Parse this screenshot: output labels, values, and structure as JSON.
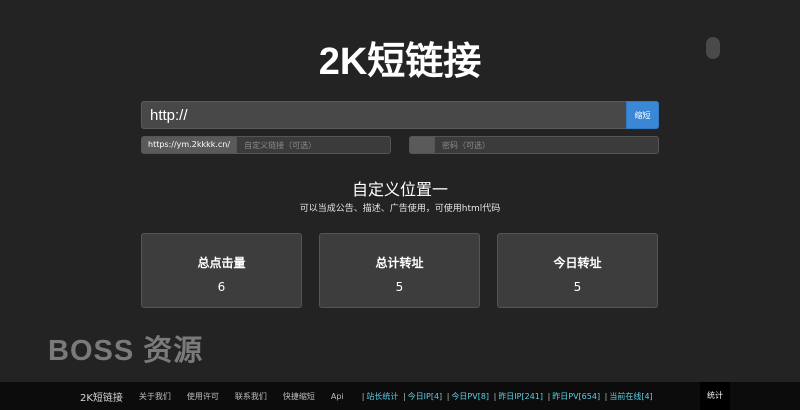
{
  "site": {
    "title": "2K短链接"
  },
  "shortener": {
    "url_value": "http://",
    "shorten_label": "缩短",
    "domain_prefix": "https://ym.2kkkk.cn/",
    "alias_placeholder": "自定义链接（可选）",
    "password_placeholder": "密码（可选）"
  },
  "ad": {
    "title": "自定义位置一",
    "description": "可以当成公告、描述、广告使用，可使用html代码"
  },
  "stats": [
    {
      "label": "总点击量",
      "value": "6"
    },
    {
      "label": "总计转址",
      "value": "5"
    },
    {
      "label": "今日转址",
      "value": "5"
    }
  ],
  "watermark": "BOSS 资源",
  "footer": {
    "brand": "2K短链接",
    "links": [
      "关于我们",
      "使用许可",
      "联系我们",
      "快捷缩短",
      "Api"
    ],
    "stats": {
      "site_stats": "站长统计",
      "today_ip": "今日IP[4]",
      "today_pv": "今日PV[8]",
      "yesterday_ip": "昨日IP[241]",
      "yesterday_pv": "昨日PV[654]",
      "online": "当前在线[4]"
    },
    "tongji": "统计"
  },
  "colors": {
    "background": "#232323",
    "accent": "#3a87d6",
    "footer_stats": "#5ad0e6"
  }
}
